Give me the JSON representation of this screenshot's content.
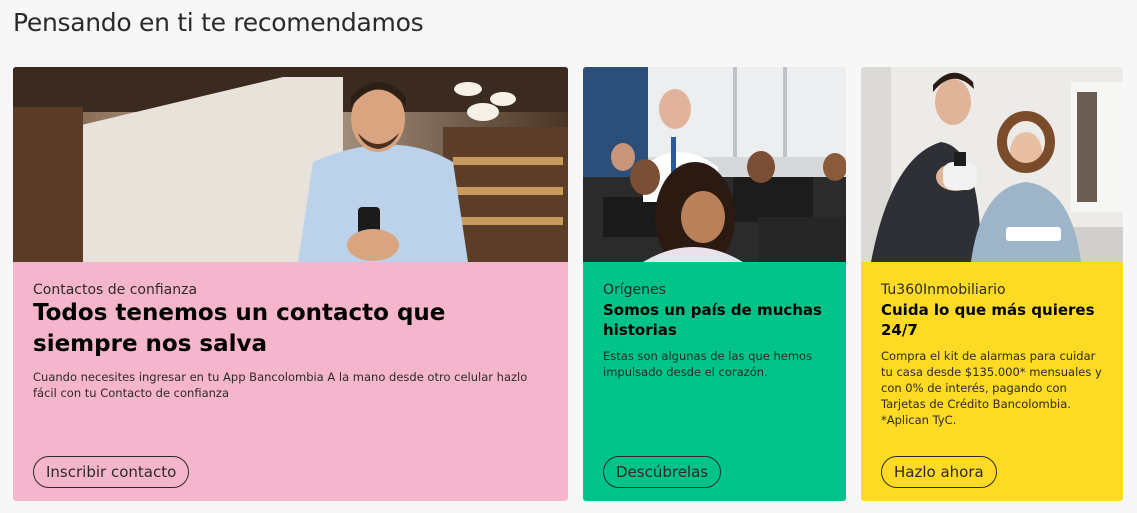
{
  "page": {
    "heading": "Pensando en ti te recomendamos"
  },
  "cards": [
    {
      "eyebrow": "Contactos de confianza",
      "title": "Todos tenemos un contacto que siempre nos salva",
      "description": "Cuando necesites ingresar en tu App Bancolombia A la mano desde otro celular hazlo fácil con tu Contacto de confianza",
      "button_label": "Inscribir contacto",
      "background_color": "#f5b6cd",
      "image_icon": "man-with-phone-photo"
    },
    {
      "eyebrow": "Orígenes",
      "title": "Somos un país de muchas historias",
      "description": "Estas son algunas de las que hemos impulsado desde el corazón.",
      "button_label": "Descúbrelas",
      "background_color": "#00c389",
      "image_icon": "classroom-photo"
    },
    {
      "eyebrow": "Tu360Inmobiliario",
      "title": "Cuida lo que más quieres 24/7",
      "description": "Compra el kit de alarmas para cuidar tu casa desde $135.000* mensuales y con 0% de interés, pagando con Tarjetas de Crédito Bancolombia.\n*Aplican TyC.",
      "button_label": "Hazlo ahora",
      "background_color": "#fdda24",
      "image_icon": "couple-with-camera-photo"
    }
  ]
}
